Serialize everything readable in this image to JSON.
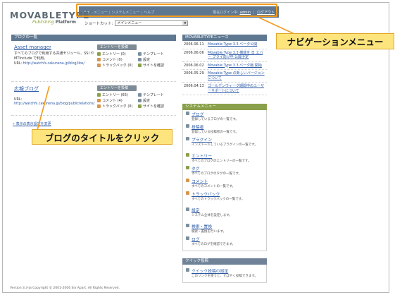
{
  "logo": {
    "word": "MOVABLETYPE",
    "tm": "®",
    "sub_prefix": "Publishing ",
    "sub_bold": "Platform"
  },
  "topnav": {
    "items": [
      "メインメニュー",
      "システムメニュー",
      "ヘルプ"
    ],
    "login_prefix": "現在ログイン中:",
    "user": "admin",
    "logout": "ログアウト"
  },
  "shortcut": {
    "label": "ショートカット:",
    "selected": "メインメニュー"
  },
  "blog_list": {
    "heading": "ブログの一覧",
    "blogs": [
      {
        "title": "Asset manager",
        "desc": "すべてのブログで利用する共通モジュール、SSI や MTInclude で利用。",
        "url_label": "URL:",
        "url": "http://watchfs.cakunena.jp/blog/libs/",
        "post": "エントリーを投稿",
        "actions": [
          "エントリー (0)",
          "テンプレート",
          "コメント (0)",
          "設定",
          "トラックバック (0)",
          "サイトを確認"
        ]
      },
      {
        "title": "広報ブログ",
        "desc": "",
        "url_label": "URL:",
        "url": "http://watchfs.cakunena.jp/blog/publicrelations/",
        "post": "エントリーを投稿",
        "actions": [
          "エントリー (65)",
          "テンプレート",
          "コメント (4)",
          "設定",
          "トラックバック (0)",
          "サイトを確認"
        ]
      }
    ],
    "display_settings": "表示の表示設定を変更"
  },
  "news": {
    "heading": "MOVABLETYPEニュース",
    "items": [
      {
        "date": "2006.06.11",
        "text": "Movable Type 3.3 ベータ公開"
      },
      {
        "date": "2006.06.06",
        "text": "Movable Type 3.3 機能を 日 エバー プライ向け中 公開予定"
      },
      {
        "date": "2006.06.02",
        "text": "Movable Type 3.3 ベータ版 開始"
      },
      {
        "date": "2006.05.29",
        "text": "Movable Type の新しいバージョンについて"
      },
      {
        "date": "2006.04.13",
        "text": "ゴールデンウィーク期間中のユーザーサポートについて"
      }
    ]
  },
  "system_menu": {
    "heading": "システムメニュー",
    "items": [
      {
        "title": "ブログ",
        "desc": "登録しているブログの一覧です。"
      },
      {
        "title": "投稿者",
        "desc": "登録している投稿者の一覧です。"
      },
      {
        "title": "プラグイン",
        "desc": "インストールしているプラグインの一覧です。"
      },
      {
        "title": "エントリー",
        "desc": "すべてのブログのエントリーの一覧です。"
      },
      {
        "title": "タグ",
        "desc": "すべてのブログのタグの一覧です。"
      },
      {
        "title": "コメント",
        "desc": "すべてのコメントの一覧です。"
      },
      {
        "title": "トラックバック",
        "desc": "すべてのトラックバックの一覧です。"
      },
      {
        "title": "設定",
        "desc": "システム全体を設定します。"
      },
      {
        "title": "検索・置換",
        "desc": "検索・置換を行います。"
      },
      {
        "title": "ログ",
        "desc": "すべてのログを確認できます。"
      }
    ]
  },
  "quick_post": {
    "heading": "クイック投稿",
    "title": "クイック投稿の設定",
    "desc": "このリンクを使うと、すばやく投稿できます。"
  },
  "footer": "Version 3.3-ja Copyright © 2001-2006 Six Apart. All Rights Reserved.",
  "callouts": {
    "nav": "ナビゲーションメニュー",
    "blog_title": "ブログのタイトルをクリック"
  },
  "colors": {
    "highlight_border": "#f39a1b",
    "callout_fill": "#fde47c",
    "header_bar": "#5d7791",
    "menu_green": "#8aa04a"
  }
}
